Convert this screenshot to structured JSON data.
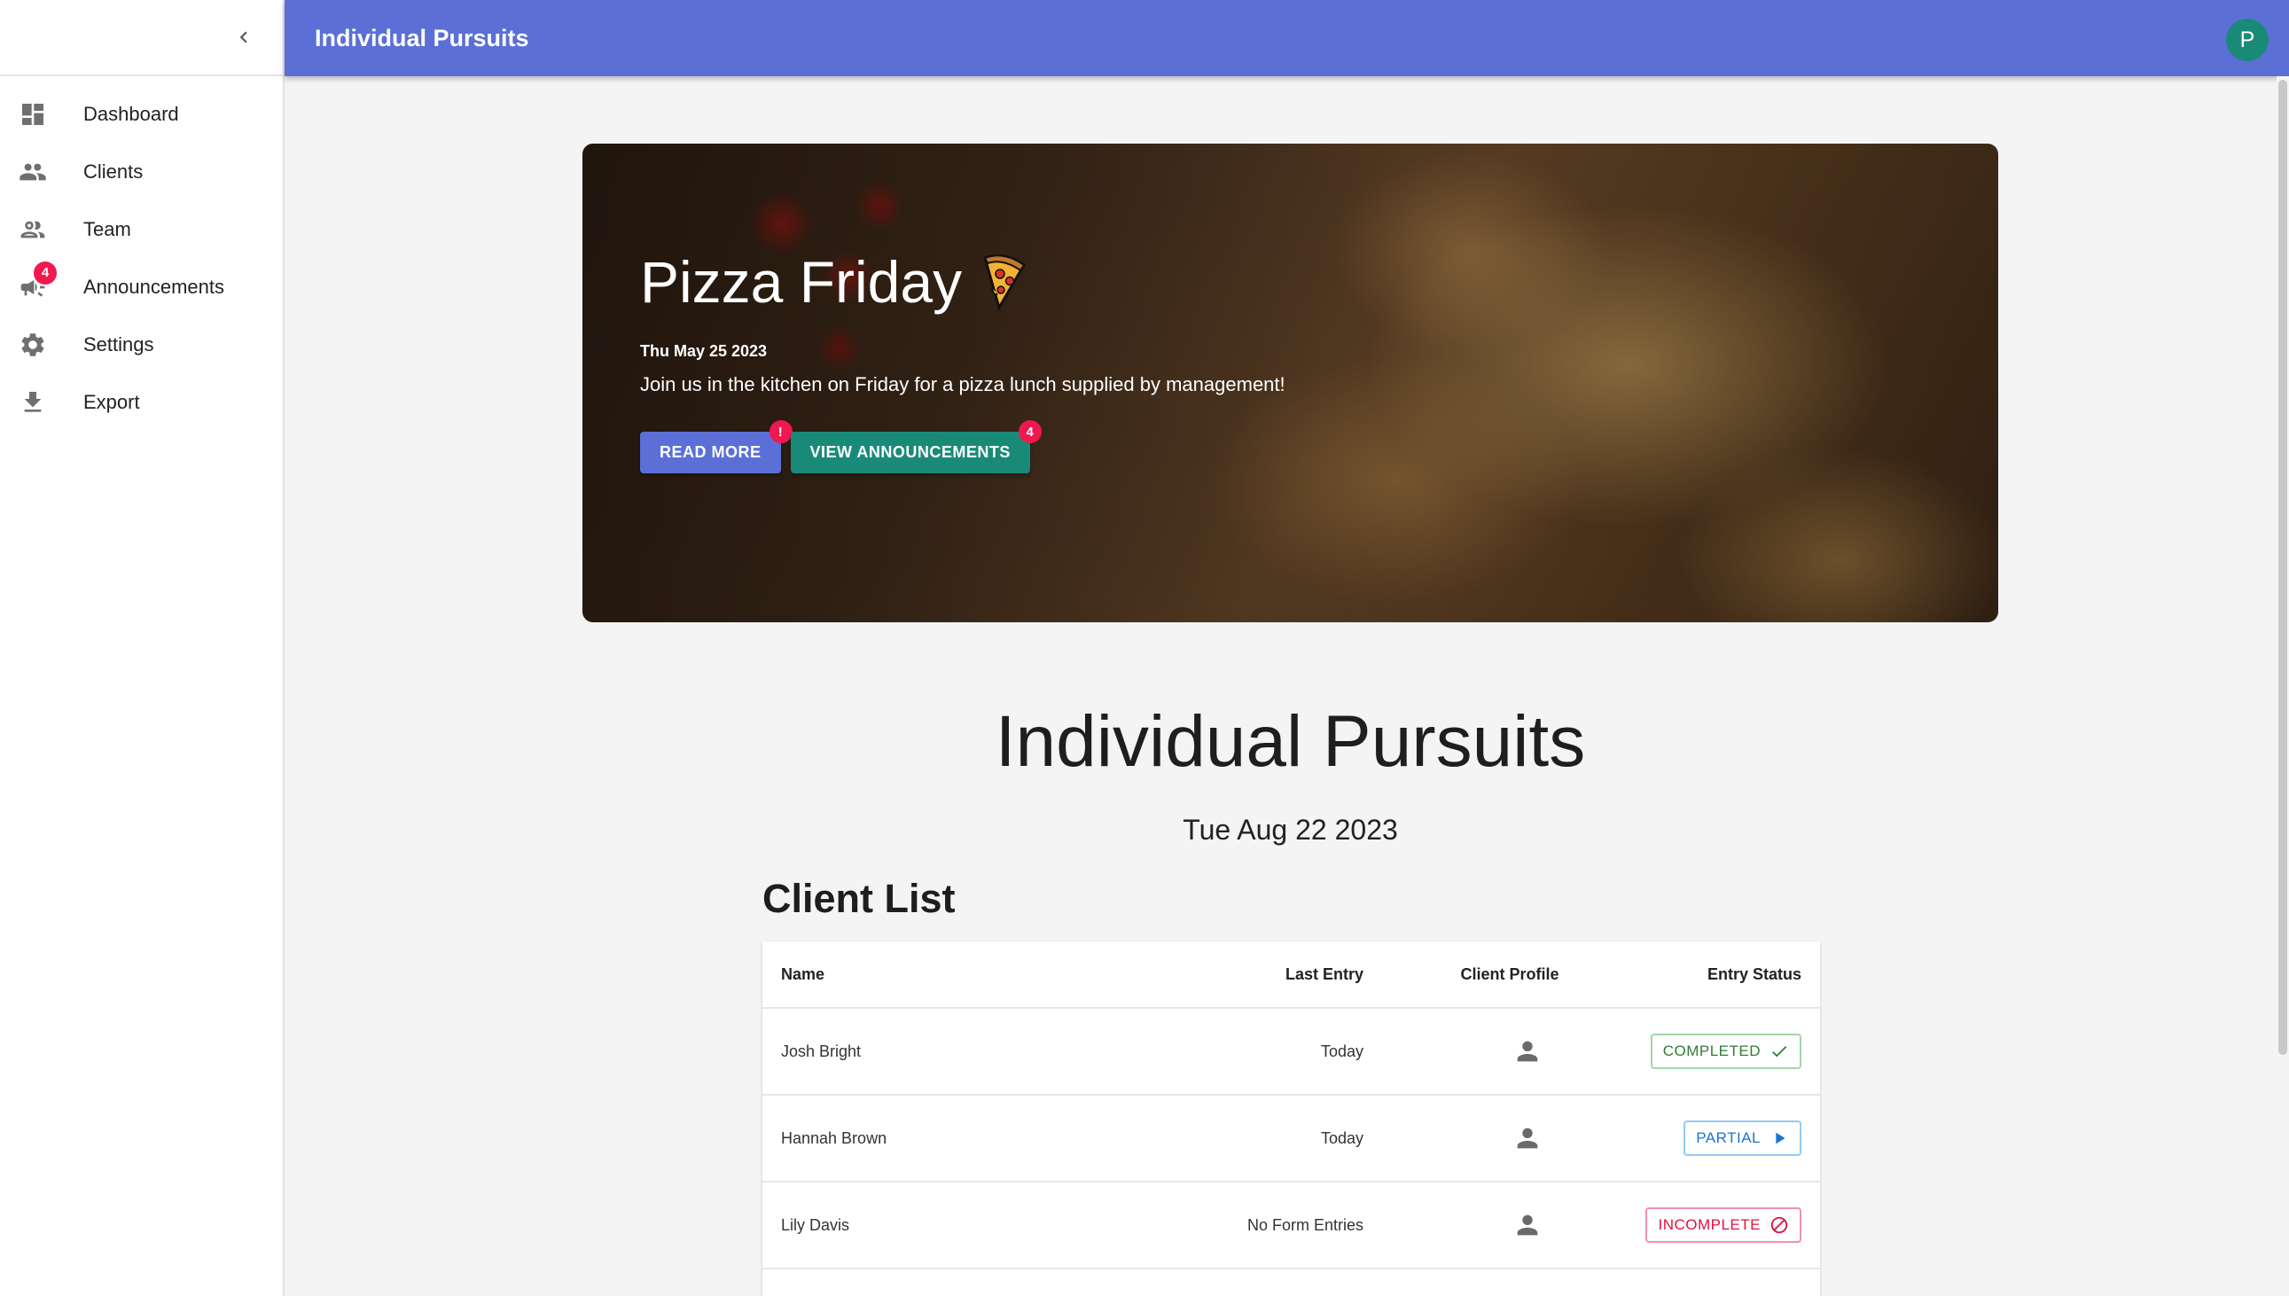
{
  "appbar": {
    "title": "Individual Pursuits",
    "avatar_initial": "P"
  },
  "sidebar": {
    "items": [
      {
        "label": "Dashboard",
        "icon": "dashboard-icon"
      },
      {
        "label": "Clients",
        "icon": "people-icon"
      },
      {
        "label": "Team",
        "icon": "group-outline-icon"
      },
      {
        "label": "Announcements",
        "icon": "megaphone-icon",
        "badge": "4"
      },
      {
        "label": "Settings",
        "icon": "gear-icon"
      },
      {
        "label": "Export",
        "icon": "download-icon"
      }
    ]
  },
  "hero": {
    "title": "Pizza Friday",
    "emoji": "pizza-icon",
    "date": "Thu May 25 2023",
    "text": "Join us in the kitchen on Friday for a pizza lunch supplied by management!",
    "read_more_label": "READ MORE",
    "read_more_badge": "!",
    "view_announcements_label": "VIEW ANNOUNCEMENTS",
    "view_announcements_badge": "4"
  },
  "page": {
    "title": "Individual Pursuits",
    "date": "Tue Aug 22 2023"
  },
  "client_list": {
    "title": "Client List",
    "headers": {
      "name": "Name",
      "last_entry": "Last Entry",
      "client_profile": "Client Profile",
      "entry_status": "Entry Status"
    },
    "rows": [
      {
        "name": "Josh Bright",
        "last_entry": "Today",
        "status": "COMPLETED"
      },
      {
        "name": "Hannah Brown",
        "last_entry": "Today",
        "status": "PARTIAL"
      },
      {
        "name": "Lily Davis",
        "last_entry": "No Form Entries",
        "status": "INCOMPLETE"
      }
    ]
  },
  "colors": {
    "primary": "#5b6fd6",
    "teal": "#1a8a78",
    "badge": "#f0184f",
    "completed": "#2e7d32",
    "partial": "#1976d2",
    "incomplete": "#e0103f"
  }
}
